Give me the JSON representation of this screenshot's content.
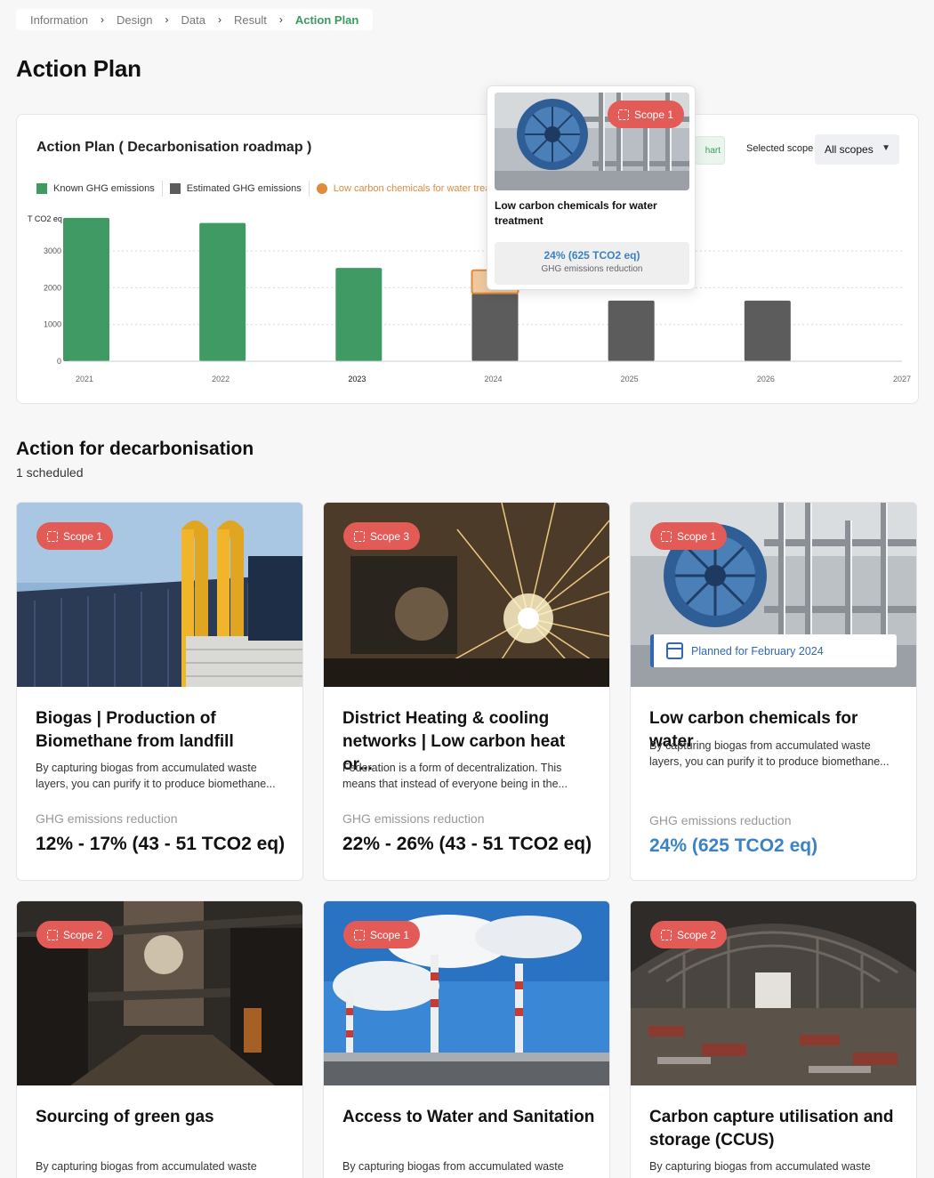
{
  "breadcrumb": {
    "items": [
      "Information",
      "Design",
      "Data",
      "Result",
      "Action Plan"
    ],
    "separator": "›"
  },
  "page_title": "Action Plan",
  "chart_panel": {
    "title": "Action Plan ( Decarbonisation roadmap )",
    "legend": {
      "known": "Known GHG emissions",
      "estimated": "Estimated GHG emissions",
      "low_carbon": "Low carbon chemicals for water trea"
    },
    "chart_button_label": "hart",
    "selected_scope_label": "Selected scope",
    "scope_value": "All scopes",
    "colors": {
      "known": "#3f9b63",
      "estimated": "#5c5c5c",
      "action": "#e08a3c"
    }
  },
  "chart_data": {
    "type": "bar",
    "ylabel": "T CO2 eq",
    "yticks": [
      0,
      1000,
      2000,
      3000
    ],
    "ylim": [
      0,
      4000
    ],
    "categories": [
      "2021",
      "2022",
      "2023",
      "2024",
      "2025",
      "2026",
      "2027"
    ],
    "series": [
      {
        "name": "Known GHG emissions",
        "values": [
          3900,
          3760,
          2540,
          null,
          null,
          null,
          null
        ]
      },
      {
        "name": "Estimated GHG emissions",
        "values": [
          null,
          null,
          null,
          1850,
          1650,
          1650,
          null
        ]
      },
      {
        "name": "Low carbon chemicals for water treatment",
        "values": [
          null,
          null,
          null,
          625,
          null,
          null,
          null
        ]
      }
    ],
    "grid": "horizontal-dotted"
  },
  "tooltip": {
    "badge": "Scope 1",
    "title": "Low carbon chemicals for water treatment",
    "value": "24% (625 TCO2 eq)",
    "sub": "GHG emissions reduction"
  },
  "section": {
    "title": "Action for decarbonisation",
    "subtitle": "1 scheduled"
  },
  "cards": [
    {
      "scope": "Scope 1",
      "title": "Biogas | Production of Biomethane from landfill",
      "desc": "By capturing biogas from accumulated waste layers, you can purify it to produce biomethane...",
      "ghg_label": "GHG emissions reduction",
      "ghg_value": "12% - 17% (43 - 51 TCO2 eq)"
    },
    {
      "scope": "Scope 3",
      "title": "District Heating & cooling networks | Low carbon heat or...",
      "desc": "Federation is a form of decentralization. This means that instead of everyone being in the...",
      "ghg_label": "GHG emissions reduction",
      "ghg_value": "22% - 26% (43 - 51 TCO2 eq)"
    },
    {
      "scope": "Scope 1",
      "title": "Low carbon chemicals for water",
      "desc": "By capturing biogas from accumulated waste layers, you can purify it to produce biomethane...",
      "ghg_label": "GHG emissions reduction",
      "ghg_value": "24% (625 TCO2 eq)",
      "planned": "Planned for February 2024"
    },
    {
      "scope": "Scope 2",
      "title": "Sourcing of green gas",
      "desc": "By capturing biogas from accumulated waste"
    },
    {
      "scope": "Scope 1",
      "title": "Access to Water and Sanitation",
      "desc": "By capturing biogas from accumulated waste"
    },
    {
      "scope": "Scope 2",
      "title": "Carbon capture utilisation and storage (CCUS)",
      "desc": "By capturing biogas from accumulated waste"
    }
  ]
}
